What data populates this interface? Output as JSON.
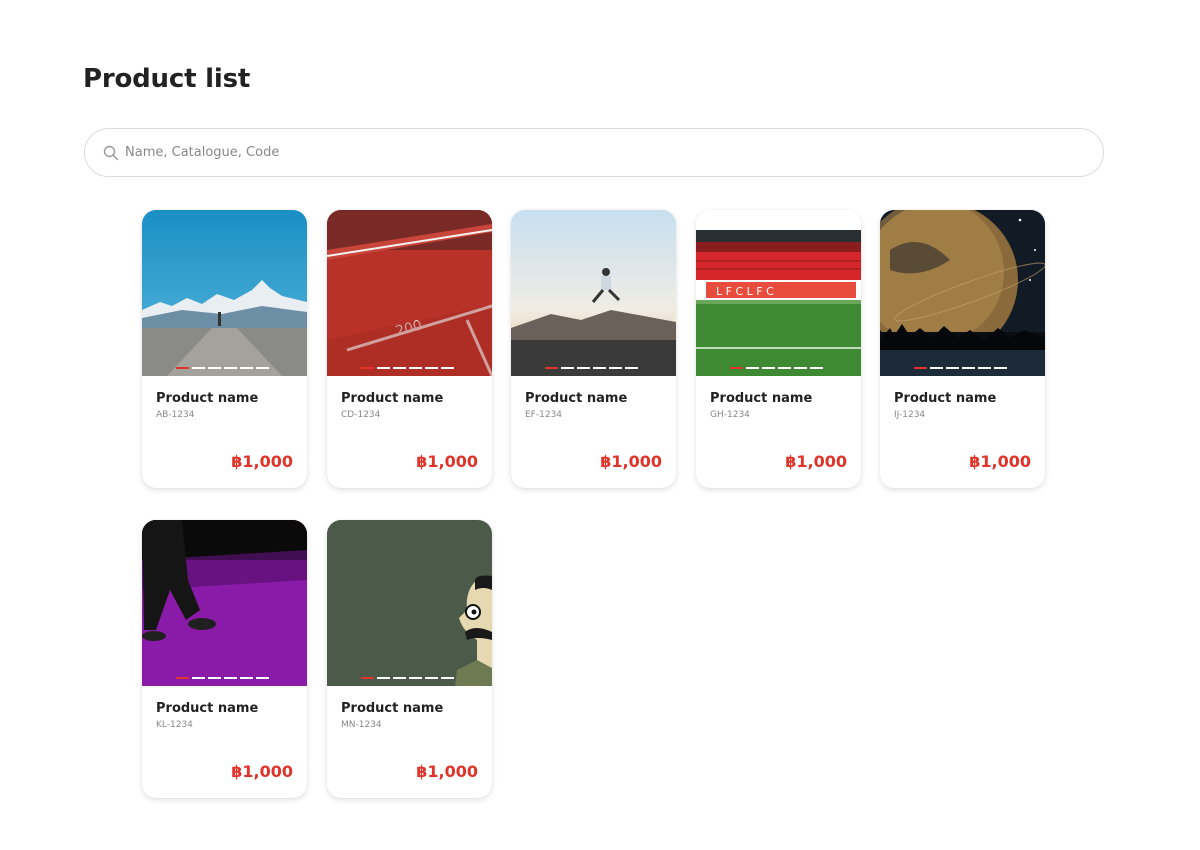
{
  "page": {
    "title": "Product list"
  },
  "search": {
    "placeholder": "Name, Catalogue, Code",
    "value": ""
  },
  "products": [
    {
      "name": "Product name",
      "code": "AB-1234",
      "price": "฿1,000",
      "image": "mountain-road"
    },
    {
      "name": "Product name",
      "code": "CD-1234",
      "price": "฿1,000",
      "image": "running-track"
    },
    {
      "name": "Product name",
      "code": "EF-1234",
      "price": "฿1,000",
      "image": "jumping-man"
    },
    {
      "name": "Product name",
      "code": "GH-1234",
      "price": "฿1,000",
      "image": "stadium"
    },
    {
      "name": "Product name",
      "code": "IJ-1234",
      "price": "฿1,000",
      "image": "planet-night"
    },
    {
      "name": "Product name",
      "code": "KL-1234",
      "price": "฿1,000",
      "image": "purple-floor-legs"
    },
    {
      "name": "Product name",
      "code": "MN-1234",
      "price": "฿1,000",
      "image": "cartoon-man"
    }
  ],
  "colors": {
    "accent": "#e0342a",
    "text": "#222222",
    "muted": "#888888",
    "border": "#dcdcdc"
  },
  "icons": {
    "search": "search-icon"
  }
}
